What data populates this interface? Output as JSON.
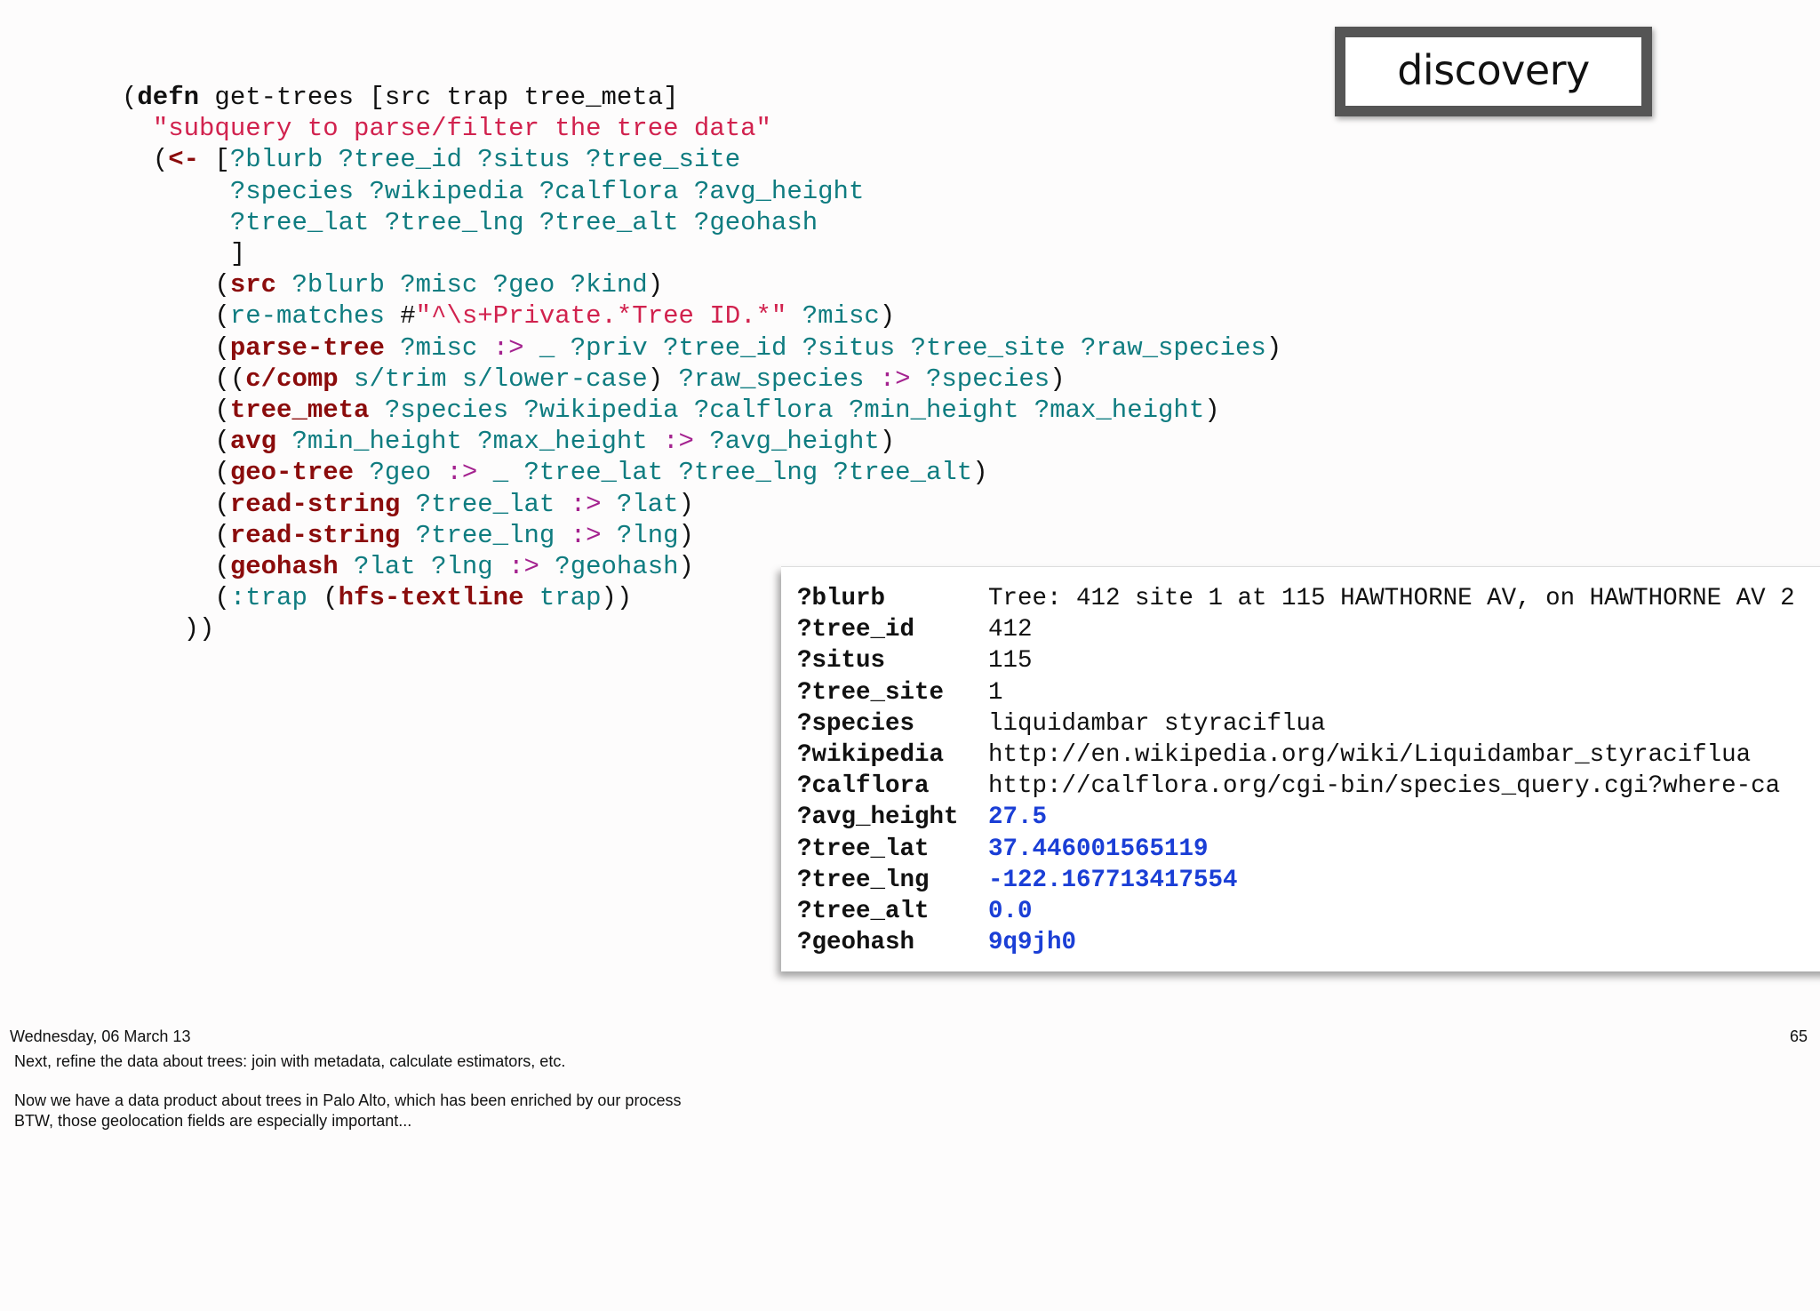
{
  "badge": {
    "label": "discovery"
  },
  "code": {
    "l1": {
      "open": "(",
      "defn": "defn",
      "rest": " get-trees [src trap tree_meta]"
    },
    "l2": {
      "docstring": "\"subquery to parse/filter the tree data\""
    },
    "l3": {
      "open": "(",
      "arrow": "<-",
      "bracket": " [",
      "vars": "?blurb ?tree_id ?situs ?tree_site"
    },
    "l4": {
      "vars": "?species ?wikipedia ?calflora ?avg_height"
    },
    "l5": {
      "vars": "?tree_lat ?tree_lng ?tree_alt ?geohash"
    },
    "l6": {
      "close": "]"
    },
    "l7": {
      "fn": "src",
      "vars": " ?blurb ?misc ?geo ?kind"
    },
    "l8": {
      "fn": "re-matches",
      "hash": " #",
      "regex": "\"^\\s+Private.*Tree ID.*\"",
      "vars": " ?misc"
    },
    "l9": {
      "fn": "parse-tree",
      "v1": " ?misc ",
      "op": ":>",
      "v2": " _ ?priv ?tree_id ?situs ?tree_site ?raw_species"
    },
    "l10": {
      "fn": "c/comp",
      "args": " s/trim s/lower-case",
      "v1": " ?raw_species ",
      "op": ":>",
      "v2": " ?species"
    },
    "l11": {
      "fn": "tree_meta",
      "vars": " ?species ?wikipedia ?calflora ?min_height ?max_height"
    },
    "l12": {
      "fn": "avg",
      "v1": " ?min_height ?max_height ",
      "op": ":>",
      "v2": " ?avg_height"
    },
    "l13": {
      "fn": "geo-tree",
      "v1": " ?geo ",
      "op": ":>",
      "v2": " _ ?tree_lat ?tree_lng ?tree_alt"
    },
    "l14": {
      "fn": "read-string",
      "v1": " ?tree_lat ",
      "op": ":>",
      "v2": " ?lat"
    },
    "l15": {
      "fn": "read-string",
      "v1": " ?tree_lng ",
      "op": ":>",
      "v2": " ?lng"
    },
    "l16": {
      "fn": "geohash",
      "v1": " ?lat ?lng ",
      "op": ":>",
      "v2": " ?geohash"
    },
    "l17": {
      "kwd": ":trap",
      "fn": "hfs-textline",
      "vars": " trap"
    },
    "l18": {
      "close": "))"
    }
  },
  "result": [
    {
      "key": "?blurb",
      "value": "Tree: 412 site 1 at 115 HAWTHORNE AV, on HAWTHORNE AV 2",
      "numeric": false
    },
    {
      "key": "?tree_id",
      "value": "412",
      "numeric": false
    },
    {
      "key": "?situs",
      "value": "115",
      "numeric": false
    },
    {
      "key": "?tree_site",
      "value": "1",
      "numeric": false
    },
    {
      "key": "?species",
      "value": "liquidambar styraciflua",
      "numeric": false
    },
    {
      "key": "?wikipedia",
      "value": "http://en.wikipedia.org/wiki/Liquidambar_styraciflua",
      "numeric": false
    },
    {
      "key": "?calflora",
      "value": " http://calflora.org/cgi-bin/species_query.cgi?where-ca",
      "numeric": false
    },
    {
      "key": "?avg_height",
      "value": "27.5",
      "numeric": true
    },
    {
      "key": "?tree_lat",
      "value": "37.446001565119",
      "numeric": true
    },
    {
      "key": "?tree_lng",
      "value": "-122.167713417554",
      "numeric": true
    },
    {
      "key": "?tree_alt",
      "value": "0.0",
      "numeric": true
    },
    {
      "key": "?geohash",
      "value": "9q9jh0",
      "numeric": true
    }
  ],
  "footer": {
    "date": "Wednesday, 06 March 13",
    "page": "65",
    "note1": "Next, refine the data about trees: join with metadata, calculate estimators, etc.",
    "note2": "Now we have a data product about trees in Palo Alto, which has been enriched by our process",
    "note3": "BTW, those geolocation fields are especially important..."
  }
}
